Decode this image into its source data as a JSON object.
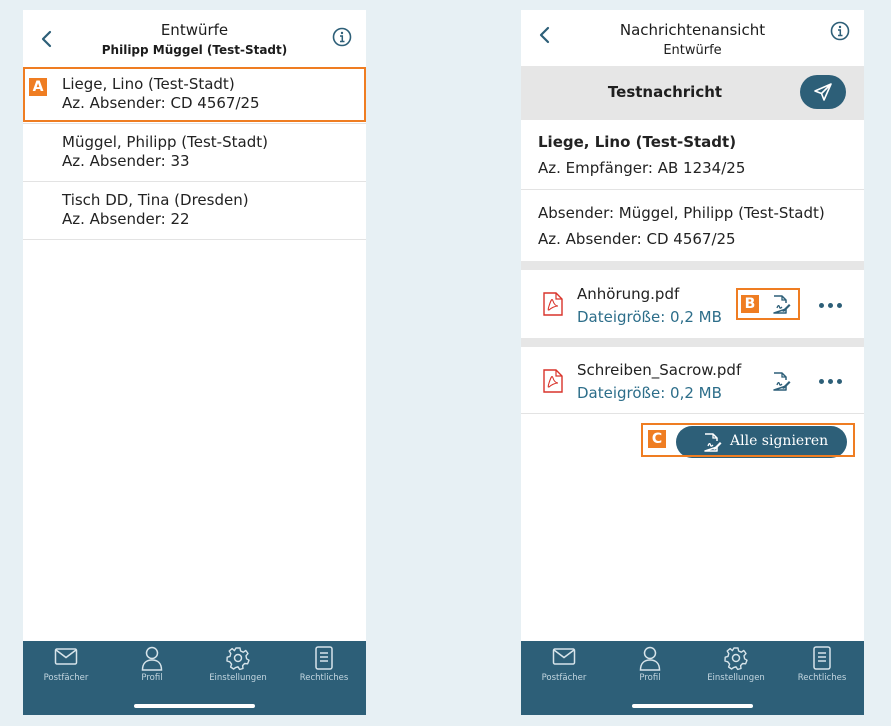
{
  "left_screen": {
    "header": {
      "title": "Entwürfe",
      "subtitle": "Philipp Müggel (Test-Stadt)"
    },
    "list": [
      {
        "name": "Liege, Lino (Test-Stadt)",
        "ref": "Az. Absender: CD 4567/25",
        "marker": "A"
      },
      {
        "name": "Müggel, Philipp (Test-Stadt)",
        "ref": "Az. Absender: 33"
      },
      {
        "name": "Tisch DD, Tina (Dresden)",
        "ref": "Az. Absender: 22"
      }
    ]
  },
  "right_screen": {
    "header": {
      "title": "Nachrichtenansicht",
      "subtitle": "Entwürfe"
    },
    "subject": "Testnachricht",
    "recipient": {
      "name": "Liege, Lino (Test-Stadt)",
      "ref": "Az. Empfänger: AB 1234/25"
    },
    "sender": {
      "name": "Absender: Müggel, Philipp (Test-Stadt)",
      "ref": "Az. Absender: CD 4567/25"
    },
    "attachments": [
      {
        "filename": "Anhörung.pdf",
        "size": "Dateigröße: 0,2 MB",
        "marker": "B"
      },
      {
        "filename": "Schreiben_Sacrow.pdf",
        "size": "Dateigröße: 0,2 MB"
      }
    ],
    "sign_all_label": "Alle signieren",
    "sign_all_marker": "C"
  },
  "tabbar": [
    {
      "label": "Postfächer",
      "icon": "mail-icon"
    },
    {
      "label": "Profil",
      "icon": "profile-icon"
    },
    {
      "label": "Einstellungen",
      "icon": "gear-icon"
    },
    {
      "label": "Rechtliches",
      "icon": "document-icon"
    }
  ],
  "colors": {
    "background": "#e7f0f4",
    "primary": "#2d5f78",
    "accent_marker": "#ef7d22",
    "link_text": "#2d6e8a",
    "pdf_red": "#d9342b"
  }
}
